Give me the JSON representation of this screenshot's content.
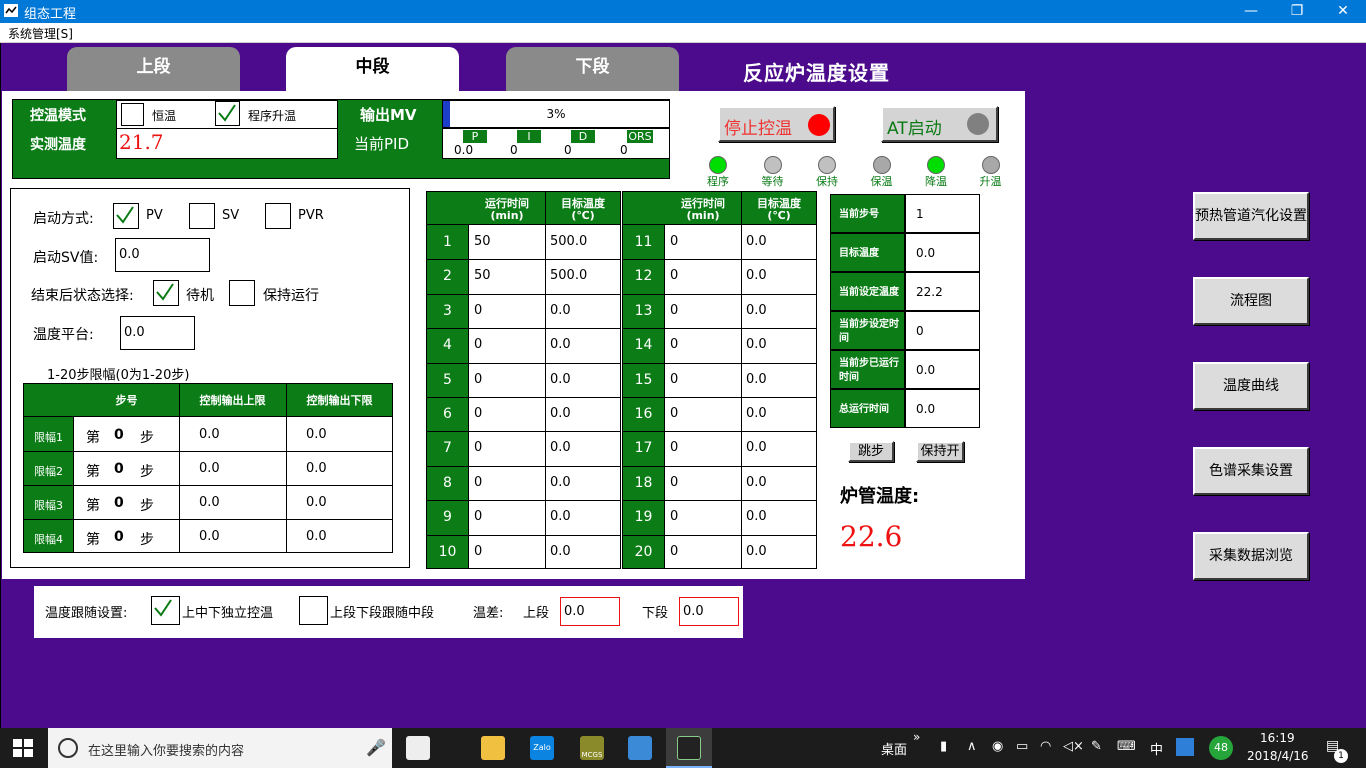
{
  "window": {
    "title": "组态工程",
    "min_icon": "minimize-icon",
    "restore_icon": "restore-icon",
    "close_icon": "close-icon"
  },
  "menu": {
    "system": "系统管理[S]"
  },
  "tabs": [
    "上段",
    "中段",
    "下段"
  ],
  "active_tab": 1,
  "heading": "反应炉温度设置",
  "control": {
    "mode_label": "控温模式",
    "opt_const": "恒温",
    "opt_prog": "程序升温",
    "const_checked": false,
    "prog_checked": true,
    "output_label": "输出MV",
    "output_value": "3%",
    "output_fraction": 0.03,
    "measured_label": "实测温度",
    "measured_value": "21.7",
    "pid_label": "当前PID",
    "pid_heads": [
      "P",
      "I",
      "D",
      "ORS"
    ],
    "pid_values": [
      "0.0",
      "0",
      "0",
      "0"
    ]
  },
  "buttons": {
    "stop": "停止控温",
    "at": "AT启动",
    "stop_lamp_color": "#ff0000",
    "at_lamp_color": "#808080"
  },
  "states": [
    {
      "label": "程序",
      "color": "#00dd00"
    },
    {
      "label": "等待",
      "color": "#c0c0c0"
    },
    {
      "label": "保持",
      "color": "#c0c0c0"
    },
    {
      "label": "保温",
      "color": "#a8a8a8"
    },
    {
      "label": "降温",
      "color": "#00dd00"
    },
    {
      "label": "升温",
      "color": "#a8a8a8"
    }
  ],
  "start": {
    "mode_label": "启动方式:",
    "opts": [
      "PV",
      "SV",
      "PVR"
    ],
    "checked": [
      true,
      false,
      false
    ],
    "sv_label": "启动SV值:",
    "sv_value": "0.0",
    "end_label": "结束后状态选择:",
    "end_opts": [
      "待机",
      "保持运行"
    ],
    "end_checked": [
      true,
      false
    ],
    "plat_label": "温度平台:",
    "plat_value": "0.0",
    "limit_title": "1-20步限幅(0为1-20步)",
    "limit_heads": [
      "步号",
      "控制输出上限",
      "控制输出下限"
    ],
    "limit_rows": [
      {
        "name": "限幅1",
        "pre": "第",
        "step": "0",
        "post": "步",
        "hi": "0.0",
        "lo": "0.0"
      },
      {
        "name": "限幅2",
        "pre": "第",
        "step": "0",
        "post": "步",
        "hi": "0.0",
        "lo": "0.0"
      },
      {
        "name": "限幅3",
        "pre": "第",
        "step": "0",
        "post": "步",
        "hi": "0.0",
        "lo": "0.0"
      },
      {
        "name": "限幅4",
        "pre": "第",
        "step": "0",
        "post": "步",
        "hi": "0.0",
        "lo": "0.0"
      }
    ]
  },
  "program": {
    "head_time": "运行时间",
    "head_time_unit": "(min)",
    "head_temp": "目标温度",
    "head_temp_unit": "(℃)",
    "left": [
      {
        "n": "1",
        "t": "50",
        "v": "500.0"
      },
      {
        "n": "2",
        "t": "50",
        "v": "500.0"
      },
      {
        "n": "3",
        "t": "0",
        "v": "0.0"
      },
      {
        "n": "4",
        "t": "0",
        "v": "0.0"
      },
      {
        "n": "5",
        "t": "0",
        "v": "0.0"
      },
      {
        "n": "6",
        "t": "0",
        "v": "0.0"
      },
      {
        "n": "7",
        "t": "0",
        "v": "0.0"
      },
      {
        "n": "8",
        "t": "0",
        "v": "0.0"
      },
      {
        "n": "9",
        "t": "0",
        "v": "0.0"
      },
      {
        "n": "10",
        "t": "0",
        "v": "0.0"
      }
    ],
    "right": [
      {
        "n": "11",
        "t": "0",
        "v": "0.0"
      },
      {
        "n": "12",
        "t": "0",
        "v": "0.0"
      },
      {
        "n": "13",
        "t": "0",
        "v": "0.0"
      },
      {
        "n": "14",
        "t": "0",
        "v": "0.0"
      },
      {
        "n": "15",
        "t": "0",
        "v": "0.0"
      },
      {
        "n": "16",
        "t": "0",
        "v": "0.0"
      },
      {
        "n": "17",
        "t": "0",
        "v": "0.0"
      },
      {
        "n": "18",
        "t": "0",
        "v": "0.0"
      },
      {
        "n": "19",
        "t": "0",
        "v": "0.0"
      },
      {
        "n": "20",
        "t": "0",
        "v": "0.0"
      }
    ]
  },
  "status": [
    {
      "label": "当前步号",
      "value": "1"
    },
    {
      "label": "目标温度",
      "value": "0.0"
    },
    {
      "label": "当前设定温度",
      "value": "22.2"
    },
    {
      "label": "当前步设定时间",
      "value": "0"
    },
    {
      "label": "当前步已运行时间",
      "value": "0.0"
    },
    {
      "label": "总运行时间",
      "value": "0.0"
    }
  ],
  "small_buttons": {
    "jump": "跳步",
    "hold": "保持开"
  },
  "tube": {
    "label": "炉管温度:",
    "value": "22.6"
  },
  "side_buttons": [
    "预热管道汽化设置",
    "流程图",
    "温度曲线",
    "色谱采集设置",
    "采集数据浏览"
  ],
  "follow": {
    "label": "温度跟随设置:",
    "opt1": "上中下独立控温",
    "opt2": "上段下段跟随中段",
    "checked1": true,
    "checked2": false,
    "diff_label": "温差:",
    "upper_label": "上段",
    "upper_value": "0.0",
    "lower_label": "下段",
    "lower_value": "0.0"
  },
  "taskbar": {
    "search_placeholder": "在这里输入你要搜索的内容",
    "desktop": "桌面",
    "chevron": "»",
    "ime": "中",
    "notif_count": "48",
    "time": "16:19",
    "date": "2018/4/16",
    "action_badge": "1",
    "app_zalo": "Zalo",
    "app_mcgs": "MCGS"
  }
}
